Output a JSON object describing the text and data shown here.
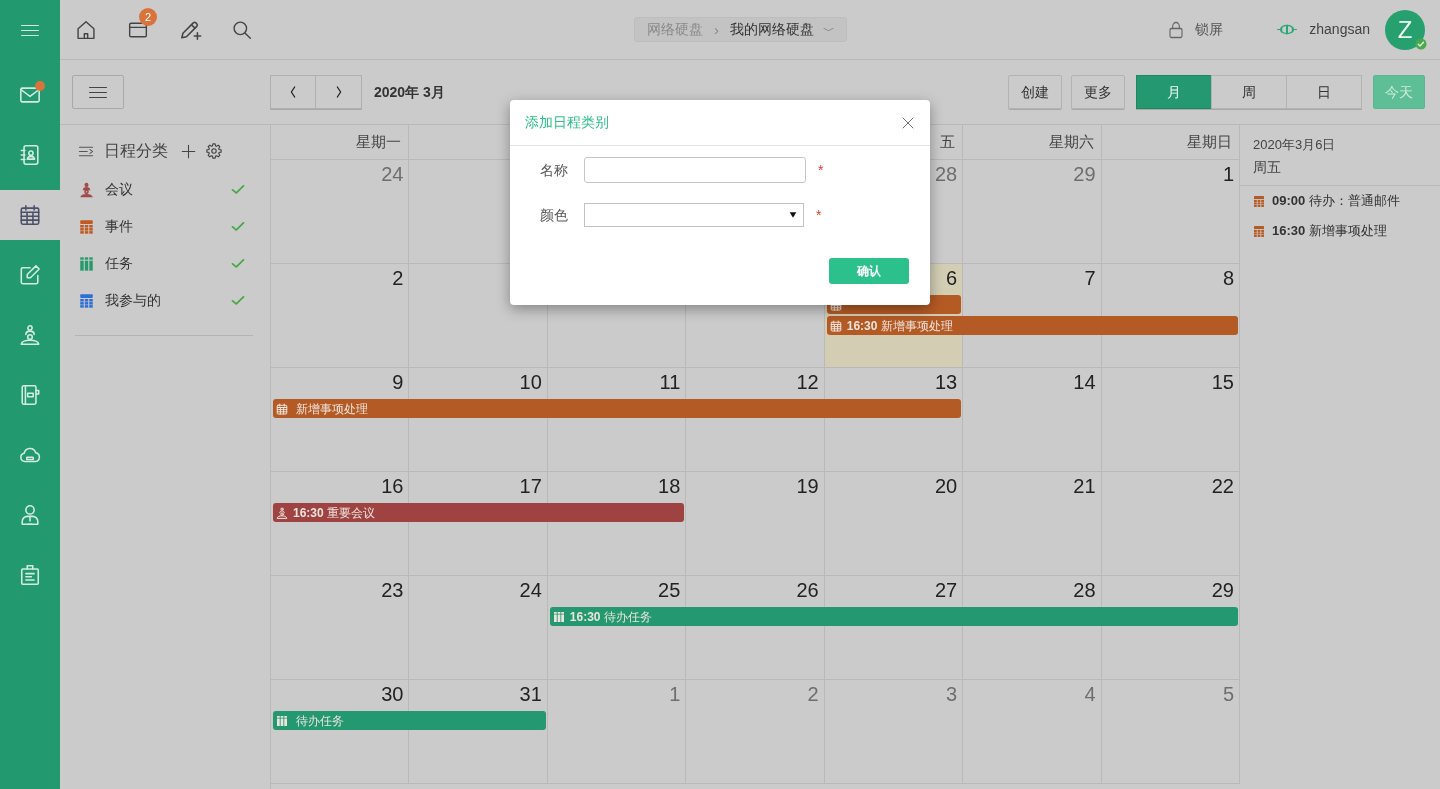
{
  "rail": {
    "items": [
      {
        "kind": "mail",
        "selected": false,
        "dot": true
      },
      {
        "kind": "contacts",
        "selected": false,
        "dot": false
      },
      {
        "kind": "calendar",
        "selected": true,
        "dot": false
      },
      {
        "kind": "notes",
        "selected": false,
        "dot": false
      },
      {
        "kind": "meeting",
        "selected": false,
        "dot": false
      },
      {
        "kind": "notebook",
        "selected": false,
        "dot": false
      },
      {
        "kind": "cloud",
        "selected": false,
        "dot": false
      },
      {
        "kind": "person",
        "selected": false,
        "dot": false
      },
      {
        "kind": "clipboard",
        "selected": false,
        "dot": false
      }
    ]
  },
  "top_bar": {
    "tools": [
      {
        "kind": "home"
      },
      {
        "kind": "tray",
        "badge": "2"
      },
      {
        "kind": "compose"
      },
      {
        "kind": "search"
      }
    ],
    "breadcrumb": [
      {
        "label": "网络硬盘",
        "current": false
      },
      {
        "label": "我的网络硬盘",
        "current": true,
        "separator": "›"
      }
    ],
    "lock": "锁屏",
    "user": {
      "name": "zhangsan",
      "initial": "Z",
      "online": true
    }
  },
  "toolbar": {
    "title": "2020年 3月",
    "actions": [
      {
        "label": "创建"
      },
      {
        "label": "更多"
      }
    ],
    "views": [
      {
        "label": "月",
        "selected": true
      },
      {
        "label": "周",
        "selected": false
      },
      {
        "label": "日",
        "selected": false
      }
    ],
    "today": {
      "label": "今天",
      "disabled": true
    }
  },
  "categories": {
    "title": "日程分类",
    "items": [
      {
        "label": "会议",
        "kind": "meeting",
        "color": "#a34a4a",
        "checked": true
      },
      {
        "label": "事件",
        "kind": "event",
        "color": "#c05a22",
        "checked": true
      },
      {
        "label": "任务",
        "kind": "task",
        "color": "#279a6c",
        "checked": true
      },
      {
        "label": "我参与的",
        "kind": "participating",
        "color": "#2c6fd6",
        "checked": true
      }
    ]
  },
  "calendar": {
    "weekdays_start": [
      "星期一"
    ],
    "weekdays_end": [
      "五",
      "星期六",
      "星期日"
    ],
    "weeks": [
      {
        "days_start": [
          {
            "label": "24",
            "other_month": true,
            "today": false
          },
          {
            "today": false
          }
        ],
        "days_end": [
          {
            "label": "28",
            "other_month": true,
            "today": false
          },
          {
            "label": "29",
            "other_month": true,
            "today": false
          },
          {
            "label": "1",
            "other_month": false,
            "today": false
          }
        ]
      },
      {
        "days": [
          {
            "label": "2",
            "other_month": false,
            "today": false
          },
          {
            "today": false
          },
          {
            "today": false
          },
          {
            "today": false
          },
          {
            "label": "6",
            "other_month": false,
            "today": true,
            "events": [
              {
                "kind": "event",
                "color": "#b45a25"
              },
              {
                "kind": "event",
                "color": "#b45a25",
                "time": "16:30",
                "title": "新增事项处理"
              }
            ]
          },
          {
            "label": "7",
            "other_month": false,
            "today": false,
            "events": [
              {
                "kind": "gap"
              },
              {
                "kind": "continued"
              }
            ]
          },
          {
            "label": "8",
            "other_month": false,
            "today": false,
            "events": [
              {
                "kind": "gap"
              },
              {
                "kind": "continued"
              }
            ]
          }
        ]
      },
      {
        "days": [
          {
            "label": "9",
            "other_month": false,
            "today": false,
            "events": [
              {
                "kind": "event",
                "color": "#b45a25",
                "title": "新增事项处理"
              }
            ]
          },
          {
            "label": "10",
            "other_month": false,
            "today": false,
            "events": [
              {
                "kind": "continued"
              }
            ]
          },
          {
            "label": "11",
            "other_month": false,
            "today": false,
            "events": [
              {
                "kind": "continued"
              }
            ]
          },
          {
            "label": "12",
            "other_month": false,
            "today": false,
            "events": [
              {
                "kind": "continued"
              }
            ]
          },
          {
            "label": "13",
            "other_month": false,
            "today": false,
            "events": [
              {
                "kind": "continued"
              }
            ]
          },
          {
            "label": "14",
            "other_month": false,
            "today": false
          },
          {
            "label": "15",
            "other_month": false,
            "today": false
          }
        ]
      },
      {
        "days": [
          {
            "label": "16",
            "other_month": false,
            "today": false,
            "events": [
              {
                "kind": "meeting",
                "color": "#9e4242",
                "time": "16:30",
                "title": "重要会议"
              }
            ]
          },
          {
            "label": "17",
            "other_month": false,
            "today": false,
            "events": [
              {
                "kind": "continued"
              }
            ]
          },
          {
            "label": "18",
            "other_month": false,
            "today": false,
            "events": [
              {
                "kind": "continued"
              }
            ]
          },
          {
            "label": "19",
            "other_month": false,
            "today": false
          },
          {
            "label": "20",
            "other_month": false,
            "today": false
          },
          {
            "label": "21",
            "other_month": false,
            "today": false
          },
          {
            "label": "22",
            "other_month": false,
            "today": false
          }
        ]
      },
      {
        "days": [
          {
            "label": "23",
            "other_month": false,
            "today": false
          },
          {
            "label": "24",
            "other_month": false,
            "today": false
          },
          {
            "label": "25",
            "other_month": false,
            "today": false,
            "events": [
              {
                "kind": "task",
                "color": "#249870",
                "time": "16:30",
                "title": "待办任务"
              }
            ]
          },
          {
            "label": "26",
            "other_month": false,
            "today": false,
            "events": [
              {
                "kind": "continued"
              }
            ]
          },
          {
            "label": "27",
            "other_month": false,
            "today": false,
            "events": [
              {
                "kind": "continued"
              }
            ]
          },
          {
            "label": "28",
            "other_month": false,
            "today": false,
            "events": [
              {
                "kind": "continued"
              }
            ]
          },
          {
            "label": "29",
            "other_month": false,
            "today": false,
            "events": [
              {
                "kind": "continued"
              }
            ]
          }
        ]
      },
      {
        "days": [
          {
            "label": "30",
            "other_month": false,
            "today": false,
            "events": [
              {
                "kind": "task",
                "color": "#249870",
                "title": "待办任务"
              }
            ]
          },
          {
            "label": "31",
            "other_month": false,
            "today": false,
            "events": [
              {
                "kind": "continued"
              }
            ]
          },
          {
            "label": "1",
            "other_month": true,
            "today": false
          },
          {
            "label": "2",
            "other_month": true,
            "today": false
          },
          {
            "label": "3",
            "other_month": true,
            "today": false
          },
          {
            "label": "4",
            "other_month": true,
            "today": false
          },
          {
            "label": "5",
            "other_month": true,
            "today": false
          }
        ]
      }
    ]
  },
  "agenda": {
    "date": "2020年3月6日",
    "weekday": "周五",
    "items": [
      {
        "kind": "event",
        "time": "09:00",
        "title": "待办：普通邮件"
      },
      {
        "kind": "event",
        "time": "16:30",
        "title": "新增事项处理"
      }
    ]
  },
  "dialog": {
    "title": "添加日程类别",
    "fields": [
      {
        "kind": "text",
        "label": "名称",
        "required_mark": "*"
      },
      {
        "kind": "select",
        "label": "颜色",
        "required_mark": "*"
      }
    ],
    "confirm": "确认"
  }
}
